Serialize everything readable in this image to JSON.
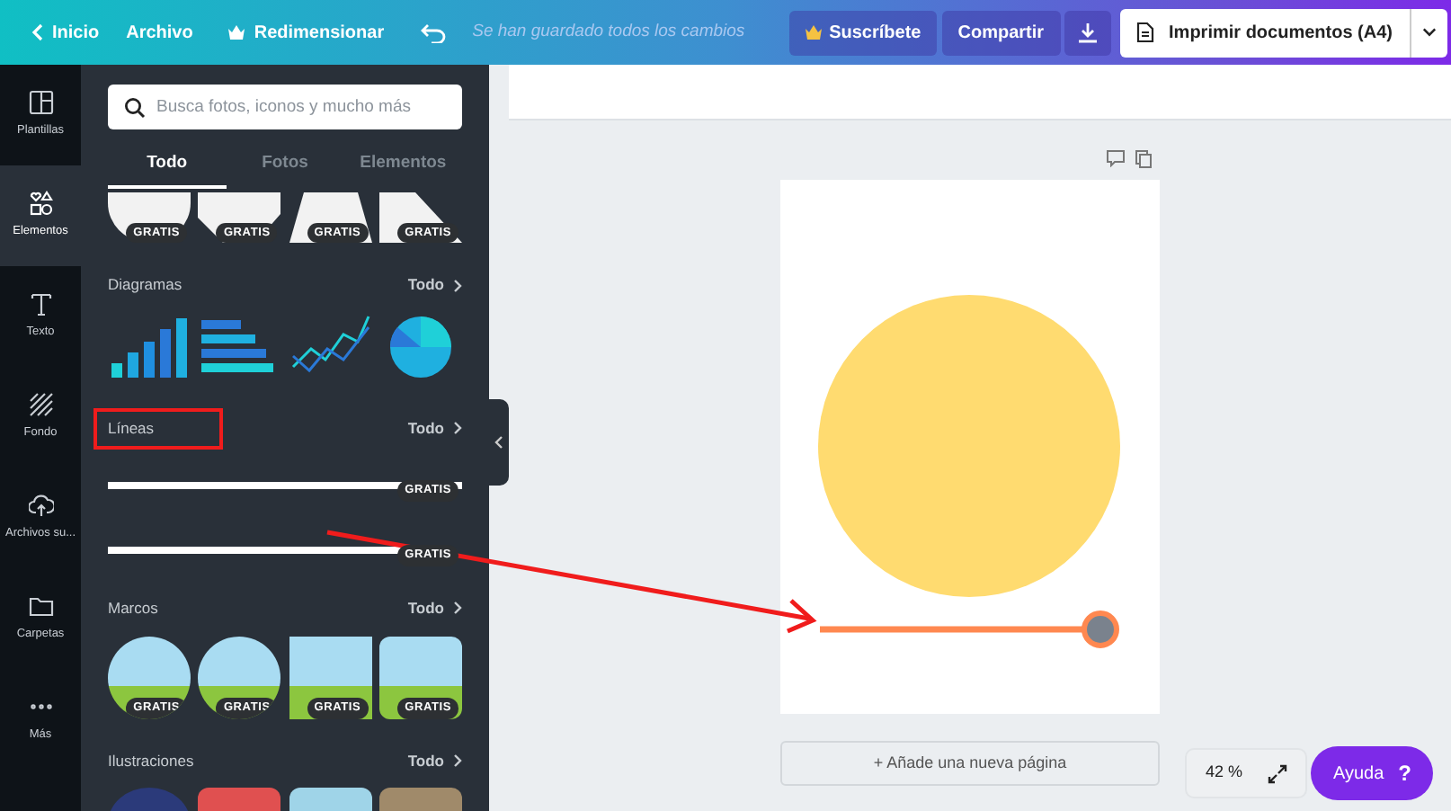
{
  "topbar": {
    "back": "Inicio",
    "file": "Archivo",
    "resize": "Redimensionar",
    "save_status": "Se han guardado todos los cambios",
    "subscribe": "Suscríbete",
    "share": "Compartir",
    "print": "Imprimir documentos (A4)"
  },
  "rail": [
    {
      "label": "Plantillas",
      "selected": false
    },
    {
      "label": "Elementos",
      "selected": true
    },
    {
      "label": "Texto",
      "selected": false
    },
    {
      "label": "Fondo",
      "selected": false
    },
    {
      "label": "Archivos su...",
      "selected": false
    },
    {
      "label": "Carpetas",
      "selected": false
    },
    {
      "label": "Más",
      "selected": false
    }
  ],
  "search": {
    "placeholder": "Busca fotos, iconos y mucho más"
  },
  "tabs": [
    {
      "label": "Todo",
      "selected": true
    },
    {
      "label": "Fotos",
      "selected": false
    },
    {
      "label": "Elementos",
      "selected": false
    }
  ],
  "sections": [
    {
      "kind": "shape",
      "items": [
        {
          "badge": "GRATIS"
        },
        {
          "badge": "GRATIS"
        },
        {
          "badge": "GRATIS"
        },
        {
          "badge": "GRATIS"
        }
      ]
    },
    {
      "kind": "chart",
      "title": "Diagramas",
      "more": "Todo",
      "highlighted": false
    },
    {
      "kind": "line",
      "title": "Líneas",
      "more": "Todo",
      "highlighted": true,
      "items": [
        {
          "badge": "GRATIS"
        },
        {
          "badge": "GRATIS"
        }
      ]
    },
    {
      "kind": "frame",
      "title": "Marcos",
      "more": "Todo",
      "highlighted": false,
      "items": [
        {
          "badge": "GRATIS"
        },
        {
          "badge": "GRATIS"
        },
        {
          "badge": "GRATIS"
        },
        {
          "badge": "GRATIS"
        }
      ]
    },
    {
      "kind": "illustration",
      "title": "Ilustraciones",
      "more": "Todo",
      "highlighted": false
    }
  ],
  "canvas": {
    "add_page": "+ Añade una nueva página",
    "zoom": "42 %",
    "help": "Ayuda",
    "help_mark": "?"
  }
}
